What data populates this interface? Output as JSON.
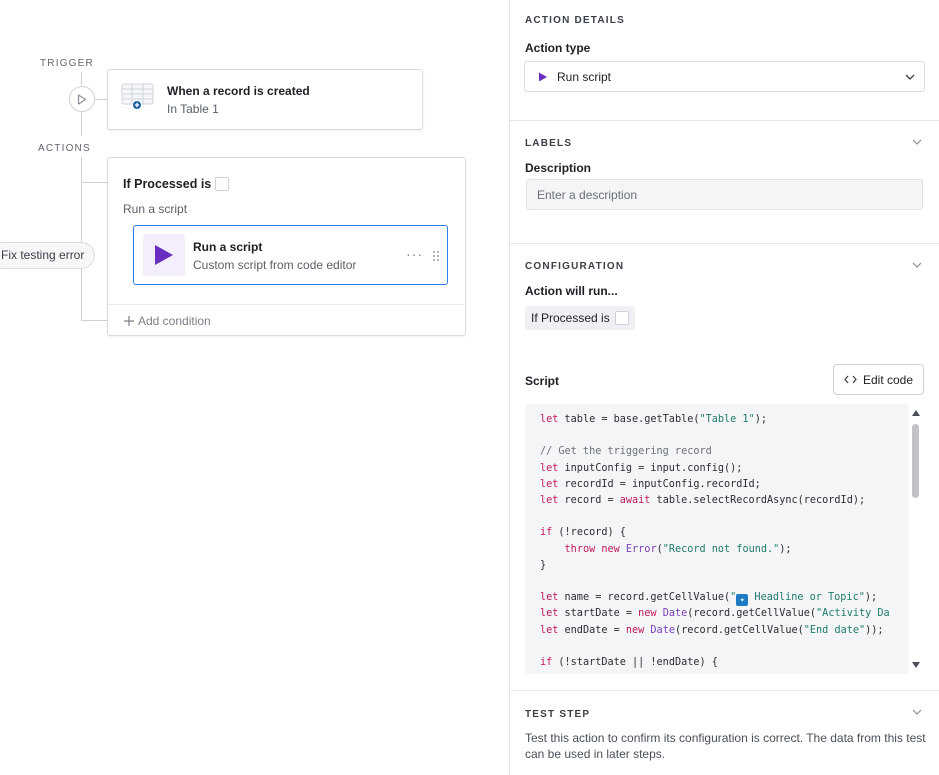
{
  "canvas": {
    "trigger_label": "TRIGGER",
    "actions_label": "ACTIONS",
    "trigger_card": {
      "title": "When a record is created",
      "subtitle": "In Table 1"
    },
    "condition_card": {
      "title": "If Processed is",
      "run_label": "Run a script",
      "script_step": {
        "title": "Run a script",
        "subtitle": "Custom script from code editor",
        "more": "···"
      },
      "add_condition": "Add condition"
    },
    "fix_pill": "Fix testing error"
  },
  "panel": {
    "action_details": {
      "heading": "ACTION DETAILS",
      "action_type_label": "Action type",
      "action_type_value": "Run script"
    },
    "labels": {
      "heading": "LABELS",
      "description_label": "Description",
      "description_placeholder": "Enter a description"
    },
    "configuration": {
      "heading": "CONFIGURATION",
      "will_run_label": "Action will run...",
      "condition_token": "If Processed is",
      "script_label": "Script",
      "edit_code_button": "Edit code"
    },
    "test_step": {
      "heading": "TEST STEP",
      "description": "Test this action to confirm its configuration is correct. The data from this test can be used in later steps."
    }
  },
  "colors": {
    "accent": "#2d7ff0",
    "script_purple": "#6a2fc0",
    "keyword": "#c2185b",
    "string": "#1f7a6d"
  }
}
